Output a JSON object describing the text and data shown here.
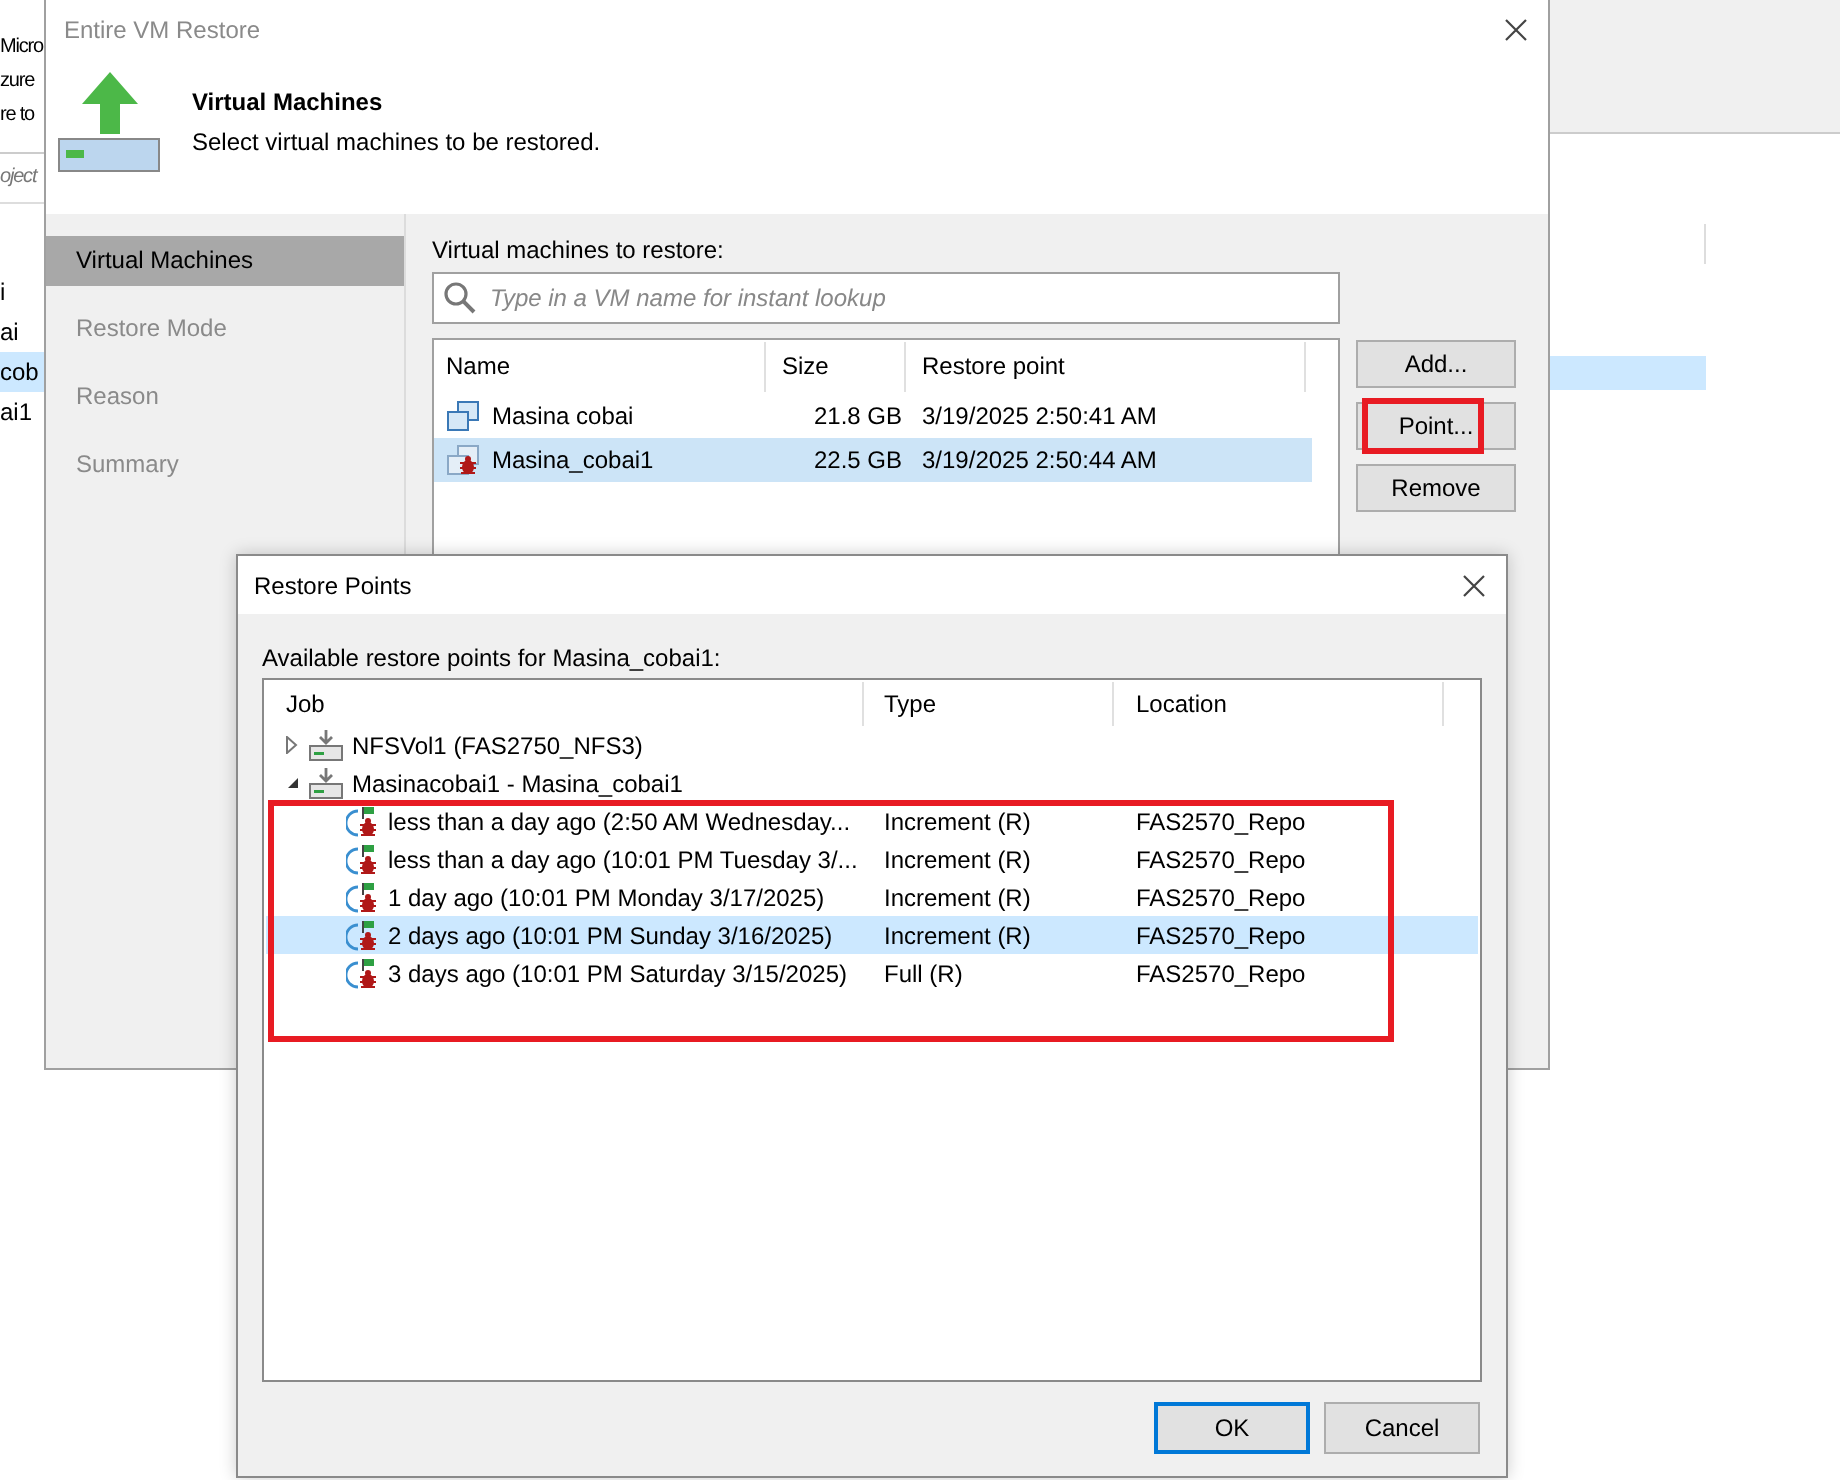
{
  "background": {
    "header_texts": [
      "Micro",
      "zure",
      "re to"
    ],
    "search": {
      "placeholder": "oject"
    },
    "list_items": [
      {
        "label": "i",
        "selected": false
      },
      {
        "label": "ai",
        "selected": false
      },
      {
        "label": "cob",
        "selected": true
      },
      {
        "label": "ai1",
        "selected": false
      }
    ]
  },
  "restore_window": {
    "title": "Entire VM Restore",
    "header": {
      "title": "Virtual Machines",
      "subtitle": "Select virtual machines to be restored."
    },
    "steps": [
      {
        "label": "Virtual Machines",
        "selected": true
      },
      {
        "label": "Restore Mode",
        "selected": false
      },
      {
        "label": "Reason",
        "selected": false
      },
      {
        "label": "Summary",
        "selected": false
      }
    ],
    "list_label": "Virtual machines to restore:",
    "search": {
      "placeholder": "Type in a VM name for instant lookup"
    },
    "table": {
      "columns": [
        "Name",
        "Size",
        "Restore point"
      ],
      "rows": [
        {
          "kind": "vm",
          "name": "Masina cobai",
          "size": "21.8 GB",
          "restore_point": "3/19/2025 2:50:41 AM",
          "selected": false
        },
        {
          "kind": "infected_vm",
          "name": "Masina_cobai1",
          "size": "22.5 GB",
          "restore_point": "3/19/2025 2:50:44 AM",
          "selected": true
        }
      ]
    },
    "buttons": [
      {
        "label": "Add...",
        "highlighted": false
      },
      {
        "label": "Point...",
        "highlighted": true
      },
      {
        "label": "Remove",
        "highlighted": false
      }
    ]
  },
  "restore_points": {
    "title": "Restore Points",
    "label": "Available restore points for Masina_cobai1:",
    "columns": [
      "Job",
      "Type",
      "Location"
    ],
    "jobs": [
      {
        "name": "NFSVol1 (FAS2750_NFS3)",
        "expanded": false
      },
      {
        "name": "Masinacobai1 - Masina_cobai1",
        "expanded": true,
        "children_highlighted": true,
        "children": [
          {
            "name": "less than a day ago (2:50 AM Wednesday...",
            "type": "Increment (R)",
            "location": "FAS2570_Repo",
            "selected": false
          },
          {
            "name": "less than a day ago (10:01 PM Tuesday 3/...",
            "type": "Increment (R)",
            "location": "FAS2570_Repo",
            "selected": false
          },
          {
            "name": "1 day ago (10:01 PM Monday 3/17/2025)",
            "type": "Increment (R)",
            "location": "FAS2570_Repo",
            "selected": false
          },
          {
            "name": "2 days ago (10:01 PM Sunday 3/16/2025)",
            "type": "Increment (R)",
            "location": "FAS2570_Repo",
            "selected": true
          },
          {
            "name": "3 days ago (10:01 PM Saturday 3/15/2025)",
            "type": "Full (R)",
            "location": "FAS2570_Repo",
            "selected": false
          }
        ]
      }
    ],
    "buttons": [
      {
        "label": "OK",
        "default": true
      },
      {
        "label": "Cancel",
        "default": false
      }
    ]
  }
}
